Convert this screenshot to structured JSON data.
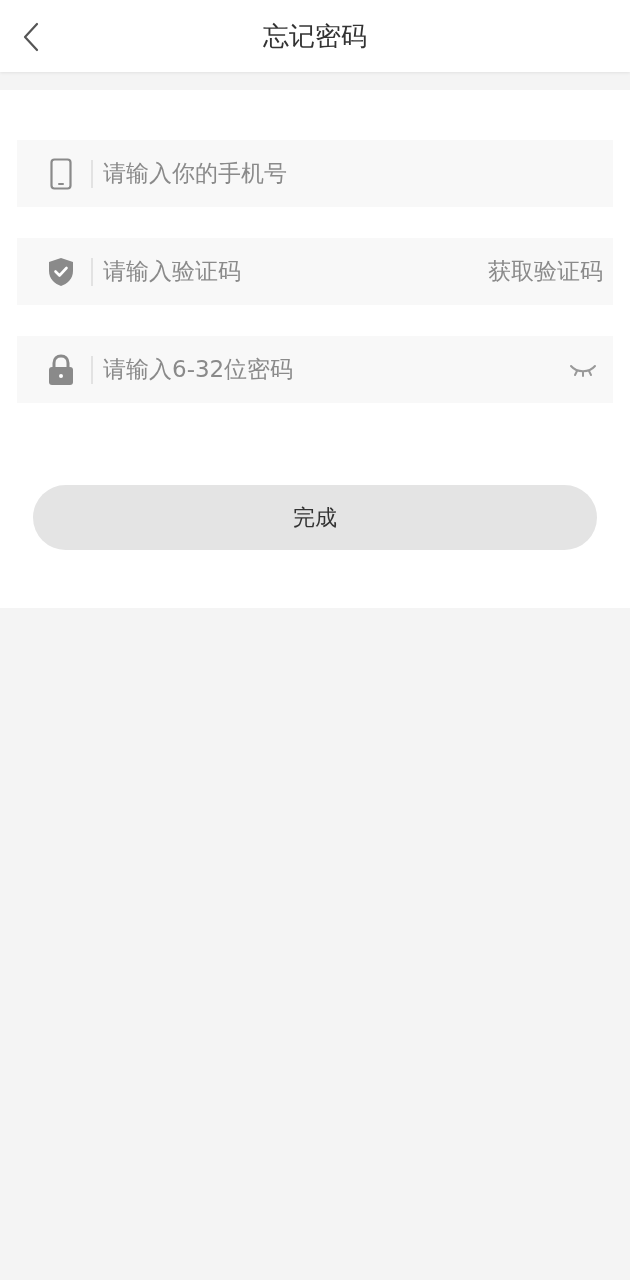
{
  "header": {
    "title": "忘记密码"
  },
  "fields": [
    {
      "kind": "phone",
      "placeholder": "请输入你的手机号"
    },
    {
      "kind": "code",
      "placeholder": "请输入验证码",
      "action": "获取验证码"
    },
    {
      "kind": "password",
      "placeholder": "请输入6-32位密码",
      "visible": false
    }
  ],
  "submit": {
    "label": "完成"
  }
}
